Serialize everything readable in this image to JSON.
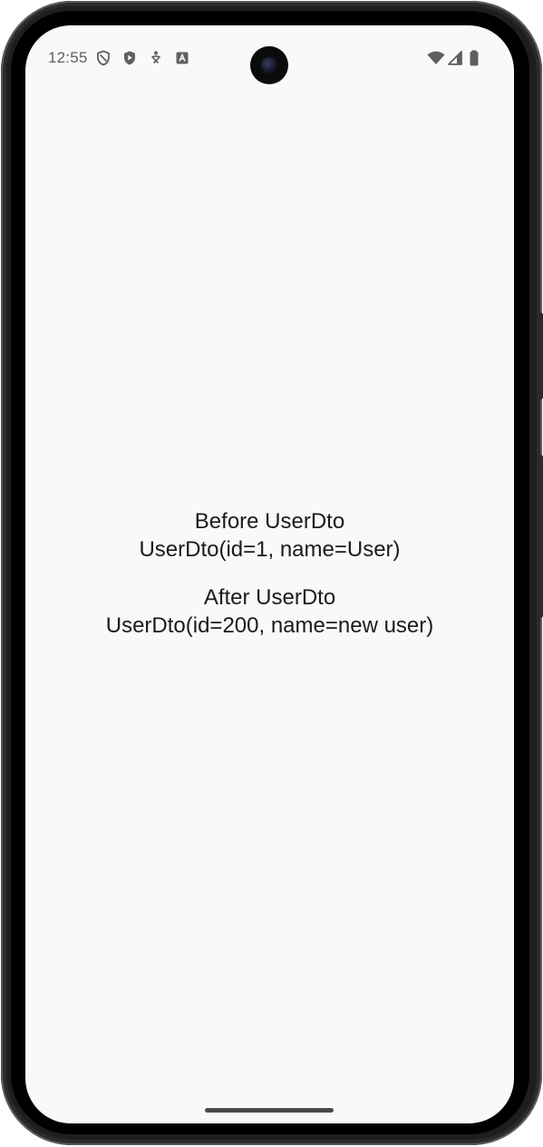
{
  "status_bar": {
    "time": "12:55",
    "icons": [
      "vpn-shield-icon",
      "play-protect-icon",
      "accessibility-icon",
      "app-notification-icon",
      "wifi-icon",
      "cellular-signal-icon",
      "battery-icon"
    ]
  },
  "content": {
    "before_title": "Before UserDto",
    "before_value": "UserDto(id=1, name=User)",
    "after_title": "After UserDto",
    "after_value": "UserDto(id=200, name=new user)"
  },
  "colors": {
    "screen_background": "#f9f9f9",
    "text": "#1b1b1b",
    "status_icon": "#5f5f5f"
  }
}
